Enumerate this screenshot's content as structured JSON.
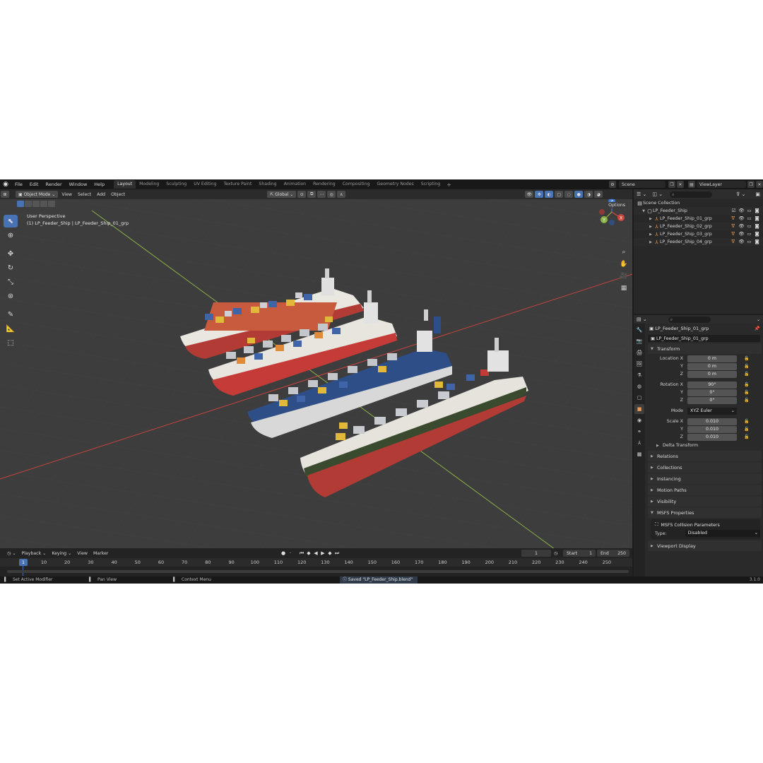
{
  "menu": {
    "items": [
      "File",
      "Edit",
      "Render",
      "Window",
      "Help"
    ],
    "workspaces": [
      "Layout",
      "Modeling",
      "Sculpting",
      "UV Editing",
      "Texture Paint",
      "Shading",
      "Animation",
      "Rendering",
      "Compositing",
      "Geometry Nodes",
      "Scripting"
    ],
    "active_workspace": "Layout",
    "add_label": "+",
    "scene": "Scene",
    "view_layer": "ViewLayer"
  },
  "viewport": {
    "mode": "Object Mode",
    "menus": [
      "View",
      "Select",
      "Add",
      "Object"
    ],
    "transform_orientation": "Global",
    "options": "Options",
    "perspective": "User Perspective",
    "active_object": "(1) LP_Feeder_Ship | LP_Feeder_Ship_01_grp",
    "axis_labels": {
      "x": "X",
      "y": "Y",
      "z": "Z"
    }
  },
  "timeline": {
    "menus": [
      "Playback",
      "Keying",
      "View",
      "Marker"
    ],
    "current_frame": "1",
    "start_label": "Start",
    "start_value": "1",
    "end_label": "End",
    "end_value": "250",
    "ruler": [
      "10",
      "20",
      "30",
      "40",
      "50",
      "60",
      "70",
      "80",
      "90",
      "100",
      "110",
      "120",
      "130",
      "140",
      "150",
      "160",
      "170",
      "180",
      "190",
      "200",
      "210",
      "220",
      "230",
      "240",
      "250"
    ]
  },
  "statusbar": {
    "left": "Set Active Modifier",
    "middle": "Pan View",
    "right": "Context Menu",
    "message": "Saved \"LP_Feeder_Ship.blend\"",
    "version": "3.1.0"
  },
  "outliner": {
    "root": "Scene Collection",
    "collection": "LP_Feeder_Ship",
    "objects": [
      "LP_Feeder_Ship_01_grp",
      "LP_Feeder_Ship_02_grp",
      "LP_Feeder_Ship_03_grp",
      "LP_Feeder_Ship_04_grp"
    ]
  },
  "properties": {
    "header_name": "LP_Feeder_Ship_01_grp",
    "object_name": "LP_Feeder_Ship_01_grp",
    "transform_title": "Transform",
    "location": {
      "label_x": "Location X",
      "x": "0 m",
      "y": "0 m",
      "z": "0 m"
    },
    "rotation": {
      "label_x": "Rotation X",
      "x": "90°",
      "y": "0°",
      "z": "0°"
    },
    "mode_label": "Mode",
    "mode_value": "XYZ Euler",
    "scale": {
      "label_x": "Scale X",
      "x": "0.010",
      "y": "0.010",
      "z": "0.010"
    },
    "axis_y": "Y",
    "axis_z": "Z",
    "delta_transform": "Delta Transform",
    "panels": [
      "Relations",
      "Collections",
      "Instancing",
      "Motion Paths",
      "Visibility"
    ],
    "msfs_title": "MSFS Properties",
    "msfs_collision": "MSFS Collision Parameters",
    "type_label": "Type:",
    "type_value": "Disabled",
    "viewport_display": "Viewport Display"
  },
  "colors": {
    "accent": "#4772b3",
    "object_orange": "#e89b55",
    "axis_red": "#d0473f",
    "axis_green": "#8cb34a"
  }
}
